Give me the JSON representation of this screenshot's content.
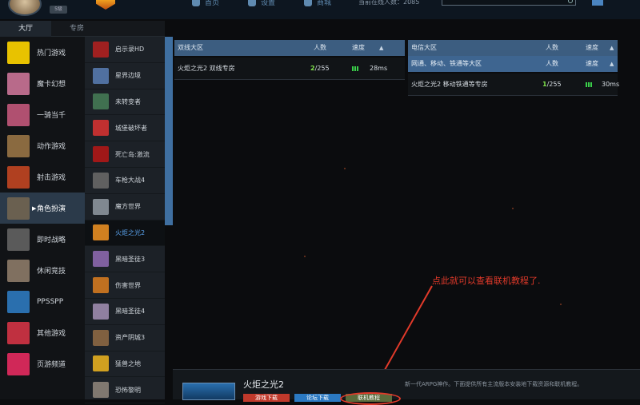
{
  "header": {
    "user_badge": "5级",
    "nav": [
      {
        "label": "首页"
      },
      {
        "label": "设置"
      },
      {
        "label": "商城"
      }
    ],
    "online_text": "当前在线人数：2085",
    "search_placeholder": ""
  },
  "tabs": [
    {
      "label": "大厅"
    },
    {
      "label": "专房"
    }
  ],
  "categories": [
    {
      "label": "热门游戏",
      "color": "#e8c200"
    },
    {
      "label": "魔卡幻想",
      "color": "#b86a8a"
    },
    {
      "label": "一骑当千",
      "color": "#b05070"
    },
    {
      "label": "动作游戏",
      "color": "#8a6a40"
    },
    {
      "label": "射击游戏",
      "color": "#b04020"
    },
    {
      "label": "角色扮演",
      "color": "#6a6050"
    },
    {
      "label": "即时战略",
      "color": "#5a5a5a"
    },
    {
      "label": "休闲竞技",
      "color": "#807060"
    },
    {
      "label": "PPSSPP",
      "color": "#2a6fae"
    },
    {
      "label": "其他游戏",
      "color": "#c03040"
    },
    {
      "label": "页游频道",
      "color": "#d02858"
    }
  ],
  "games": [
    {
      "label": "启示录HD",
      "color": "#a02020"
    },
    {
      "label": "星界边境",
      "color": "#5070a0"
    },
    {
      "label": "未转变者",
      "color": "#407050"
    },
    {
      "label": "城堡破坏者",
      "color": "#c03030"
    },
    {
      "label": "死亡岛:激流",
      "color": "#a01818"
    },
    {
      "label": "车枪大战4",
      "color": "#606060"
    },
    {
      "label": "魔方世界",
      "color": "#808890"
    },
    {
      "label": "火炬之光2",
      "color": "#d08020"
    },
    {
      "label": "黑暗圣徒3",
      "color": "#8060a0"
    },
    {
      "label": "伤害世界",
      "color": "#c07020"
    },
    {
      "label": "黑暗圣徒4",
      "color": "#9080a0"
    },
    {
      "label": "资产阴城3",
      "color": "#806040"
    },
    {
      "label": "猛兽之地",
      "color": "#d0a020"
    },
    {
      "label": "恐怖黎明",
      "color": "#807870"
    }
  ],
  "left_panel": {
    "header": {
      "name": "双线大区",
      "count": "人数",
      "speed": "速度",
      "sort": "▲"
    },
    "rows": [
      {
        "name": "火炬之光2 双线专房",
        "count": "2",
        "max": "/255",
        "speed": "28ms"
      }
    ]
  },
  "right_panel": {
    "header": {
      "name": "电信大区",
      "count": "人数",
      "speed": "速度",
      "sort": "▲"
    },
    "subheader": {
      "name": "网通、移动、铁通等大区",
      "count": "人数",
      "speed": "速度",
      "sort": "▲"
    },
    "rows": [
      {
        "name": "火炬之光2 移动铁通等专房",
        "count": "1",
        "max": "/255",
        "speed": "30ms"
      }
    ]
  },
  "annotation": {
    "text": "点此就可以查看联机教程了.",
    "color": "#e23a2a"
  },
  "bottom": {
    "title": "火炬之光2",
    "description": "新一代ARPG神作。下面提供所有主流版本安装地下载资源和联机教程。",
    "download_label": "游戏下载",
    "bbs_label": "论坛下载",
    "tutorial_label": "联机教程"
  }
}
